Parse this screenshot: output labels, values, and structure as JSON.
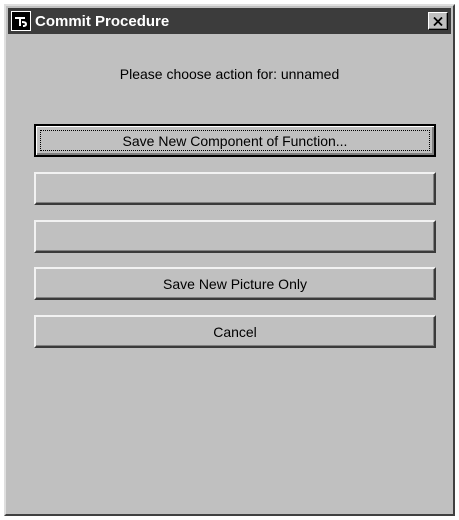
{
  "window": {
    "title": "Commit Procedure",
    "close_label": "X",
    "icon": "app-logo-icon"
  },
  "dialog": {
    "prompt": "Please choose action for: unnamed"
  },
  "buttons": {
    "save_component": "Save New Component of Function...",
    "blank_1": "",
    "blank_2": "",
    "save_picture": "Save New Picture Only",
    "cancel": "Cancel"
  },
  "colors": {
    "titlebar": "#3c3c3c",
    "face": "#c0c0c0",
    "title_text": "#ffffff"
  }
}
